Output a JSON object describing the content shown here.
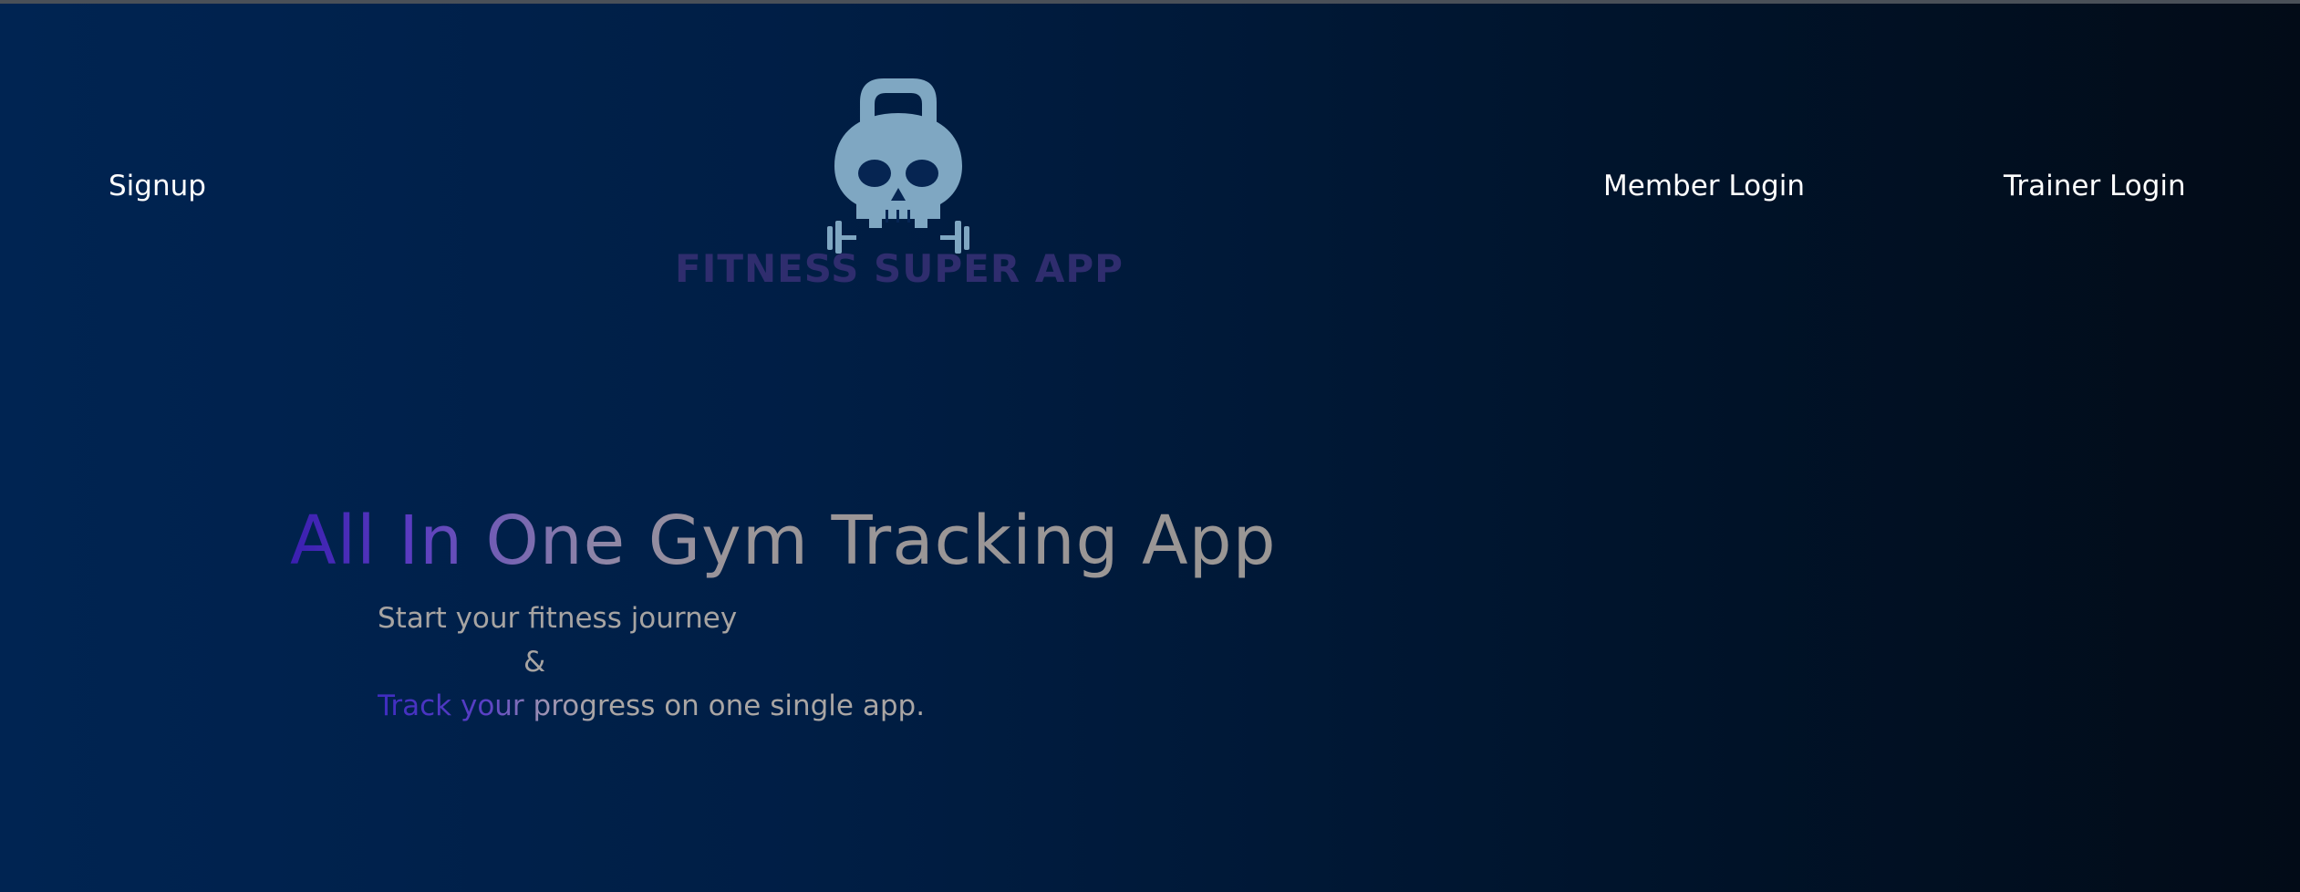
{
  "nav": {
    "signup_label": "Signup",
    "member_login_label": "Member Login",
    "trainer_login_label": "Trainer Login"
  },
  "logo": {
    "icon": "kettlebell-skull-icon",
    "text": "FITNESS SUPER APP"
  },
  "hero": {
    "title": "All In One Gym Tracking App",
    "subtitle_line1": "Start your fitness journey",
    "subtitle_line2": "&",
    "subtitle_line3": "Track your progress on one single app."
  },
  "colors": {
    "background_start": "#002452",
    "background_end": "#020b17",
    "accent_purple": "#3a1fb0",
    "logo_icon": "#7fa7c2",
    "logo_text": "#2f2d6e",
    "nav_text": "#ffffff",
    "muted_text": "#a7a4a2"
  }
}
